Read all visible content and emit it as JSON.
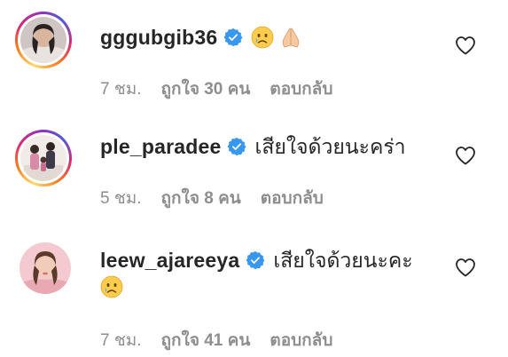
{
  "comments": [
    {
      "username": "gggubgib36",
      "text": "",
      "emojis": [
        "crying-face",
        "folded-hands"
      ],
      "time": "7 ชม.",
      "likes": "ถูกใจ 30 คน",
      "reply": "ตอบกลับ",
      "has_story_ring": true
    },
    {
      "username": "ple_paradee",
      "text": "เสียใจด้วยนะคร่า",
      "emojis": [],
      "time": "5 ชม.",
      "likes": "ถูกใจ 8 คน",
      "reply": "ตอบกลับ",
      "has_story_ring": true
    },
    {
      "username": "leew_ajareeya",
      "text": "เสียใจด้วยนะคะ",
      "emojis": [
        "crying-face"
      ],
      "time": "7 ชม.",
      "likes": "ถูกใจ 41 คน",
      "reply": "ตอบกลับ",
      "has_story_ring": false
    }
  ],
  "colors": {
    "text": "#262626",
    "secondary": "#8e8e8e",
    "verified": "#3897f0"
  }
}
